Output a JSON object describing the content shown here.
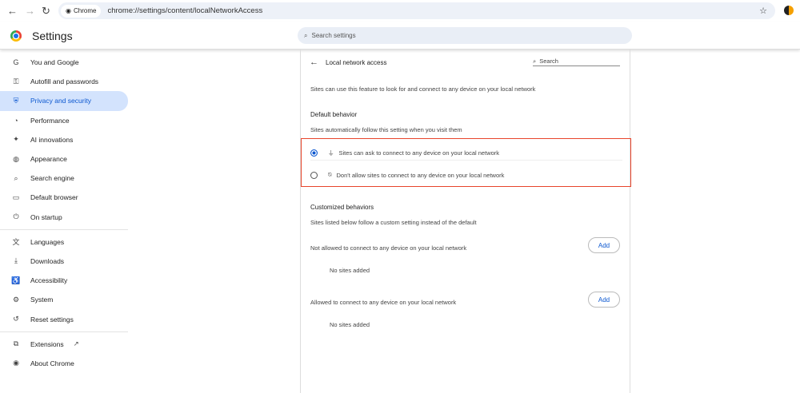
{
  "browser": {
    "chip": "Chrome",
    "url": "chrome://settings/content/localNetworkAccess"
  },
  "header": {
    "title": "Settings",
    "search_placeholder": "Search settings"
  },
  "sidebar": {
    "items": [
      {
        "label": "You and Google",
        "icon": "G"
      },
      {
        "label": "Autofill and passwords",
        "icon": "⚿"
      },
      {
        "label": "Privacy and security",
        "icon": "⛨"
      },
      {
        "label": "Performance",
        "icon": "◔"
      },
      {
        "label": "AI innovations",
        "icon": "✦"
      },
      {
        "label": "Appearance",
        "icon": "◍"
      },
      {
        "label": "Search engine",
        "icon": "⌕"
      },
      {
        "label": "Default browser",
        "icon": "▭"
      },
      {
        "label": "On startup",
        "icon": "⏻"
      },
      {
        "label": "Languages",
        "icon": "文"
      },
      {
        "label": "Downloads",
        "icon": "⤓"
      },
      {
        "label": "Accessibility",
        "icon": "♿"
      },
      {
        "label": "System",
        "icon": "⚙"
      },
      {
        "label": "Reset settings",
        "icon": "↺"
      },
      {
        "label": "Extensions",
        "icon": "⧉"
      },
      {
        "label": "About Chrome",
        "icon": "◉"
      }
    ]
  },
  "main": {
    "page_title": "Local network access",
    "search_placeholder": "Search",
    "description": "Sites can use this feature to look for and connect to any device on your local network",
    "default_heading": "Default behavior",
    "default_sub": "Sites automatically follow this setting when you visit them",
    "options": [
      {
        "label": "Sites can ask to connect to any device on your local network",
        "selected": true
      },
      {
        "label": "Don't allow sites to connect to any device on your local network",
        "selected": false
      }
    ],
    "custom_heading": "Customized behaviors",
    "custom_sub": "Sites listed below follow a custom setting instead of the default",
    "not_allowed_label": "Not allowed to connect to any device on your local network",
    "allowed_label": "Allowed to connect to any device on your local network",
    "add_label": "Add",
    "empty": "No sites added"
  }
}
